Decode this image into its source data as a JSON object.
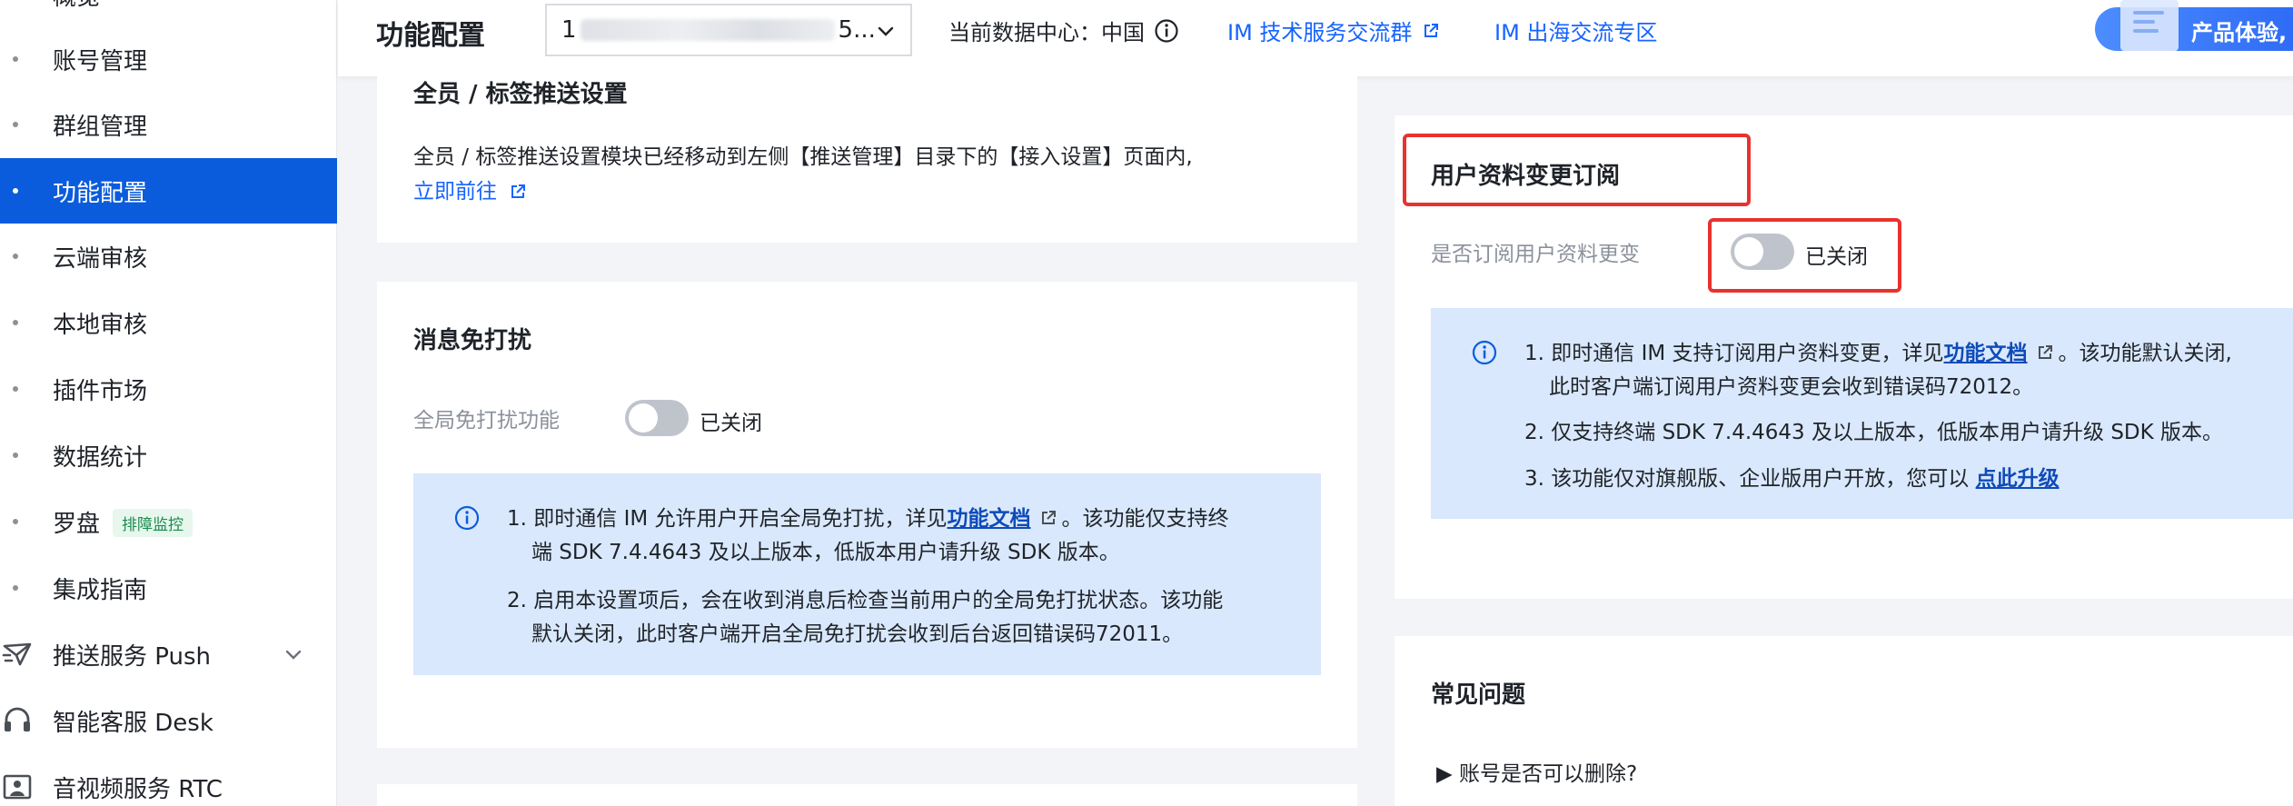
{
  "sidebar": {
    "top_partial": "概览",
    "items": [
      {
        "label": "账号管理"
      },
      {
        "label": "群组管理"
      },
      {
        "label": "功能配置"
      },
      {
        "label": "云端审核"
      },
      {
        "label": "本地审核"
      },
      {
        "label": "插件市场"
      },
      {
        "label": "数据统计"
      },
      {
        "label": "罗盘",
        "badge": "排障监控"
      },
      {
        "label": "集成指南"
      }
    ],
    "products": [
      {
        "label": "推送服务 Push",
        "icon": "send-plane-icon"
      },
      {
        "label": "智能客服 Desk",
        "icon": "headset-icon"
      },
      {
        "label": "音视频服务 RTC",
        "icon": "video-user-icon"
      }
    ]
  },
  "topbar": {
    "title": "功能配置",
    "app_select_prefix": "1",
    "app_select_suffix": "5...",
    "datacenter": "当前数据中心：中国",
    "link_tech_group": "IM 技术服务交流群",
    "link_overseas": "IM 出海交流专区",
    "promo": "产品体验,"
  },
  "push_card": {
    "title": "全员 / 标签推送设置",
    "desc": "全员 / 标签推送设置模块已经移动到左侧【推送管理】目录下的【接入设置】页面内,",
    "link": "立即前往"
  },
  "dnd_card": {
    "title": "消息免打扰",
    "field_label": "全局免打扰功能",
    "toggle_state": "已关闭",
    "notes": {
      "n1_a": "1. 即时通信 IM 允许用户开启全局免打扰，详见",
      "n1_link": "功能文档",
      "n1_b": "。该功能仅支持终",
      "n1_c": "端 SDK 7.4.4643 及以上版本，低版本用户请升级 SDK 版本。",
      "n2_a": "2. 启用本设置项后，会在收到消息后检查当前用户的全局免打扰状态。该功能",
      "n2_b": "默认关闭，此时客户端开启全局免打扰会收到后台返回错误码72011。"
    }
  },
  "profile_card": {
    "title": "用户资料变更订阅",
    "field_label": "是否订阅用户资料更变",
    "toggle_state": "已关闭",
    "notes": {
      "n1_a": "1. 即时通信 IM 支持订阅用户资料变更，详见",
      "n1_link": "功能文档",
      "n1_b": "。该功能默认关闭,",
      "n1_c": "此时客户端订阅用户资料变更会收到错误码72012。",
      "n2": "2. 仅支持终端 SDK 7.4.4643 及以上版本，低版本用户请升级 SDK 版本。",
      "n3_a": "3. 该功能仅对旗舰版、企业版用户开放，您可以 ",
      "n3_link": "点此升级"
    }
  },
  "faq_card": {
    "title": "常见问题",
    "items": [
      "▶ 账号是否可以删除?"
    ]
  },
  "colors": {
    "active_nav": "#0b5cdc",
    "link": "#1664ff",
    "notice_bg": "#d9e8fc",
    "highlight": "#e8322f"
  }
}
